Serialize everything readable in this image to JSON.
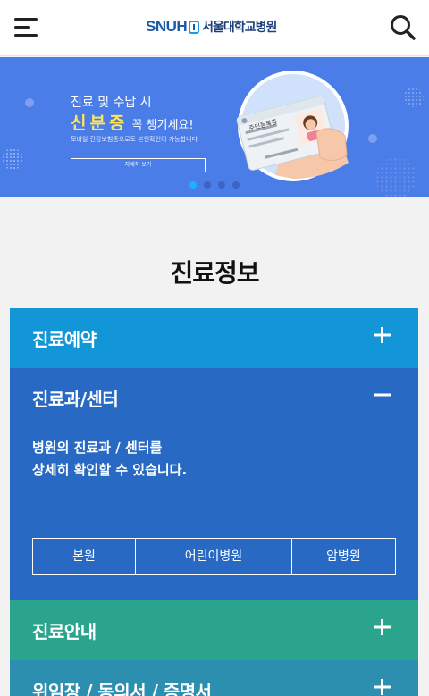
{
  "header": {
    "logo_text": "SNUH",
    "logo_name": "서울대학교병원"
  },
  "banner": {
    "line1": "진료 및 수납 시",
    "highlight": "신분증",
    "line2_rest": "꼭 챙기세요!",
    "line3": "모바일 건강보험증으로도 본인확인이 가능합니다.",
    "button_label": "자세히 보기",
    "card_label": "주민등록증",
    "slides": 4,
    "active_slide": 1,
    "bg_color": "#4a7de8",
    "highlight_color": "#ffe45c"
  },
  "section": {
    "title": "진료정보"
  },
  "accordion": [
    {
      "label": "진료예약",
      "icon": "plus-icon",
      "expanded": false,
      "color": "#1296d8"
    },
    {
      "label": "진료과/센터",
      "icon": "minus-icon",
      "expanded": true,
      "color": "#2869c4",
      "desc_line1": "병원의 진료과 / 센터를",
      "desc_line2": "상세히 확인할 수 있습니다.",
      "sub_buttons": [
        "본원",
        "어린이병원",
        "암병원"
      ]
    },
    {
      "label": "진료안내",
      "icon": "plus-icon",
      "expanded": false,
      "color": "#2aa48c"
    },
    {
      "label": "위임장 / 동의서 / 증명서",
      "icon": "plus-icon",
      "expanded": false,
      "color": "#2d8fb0"
    }
  ]
}
